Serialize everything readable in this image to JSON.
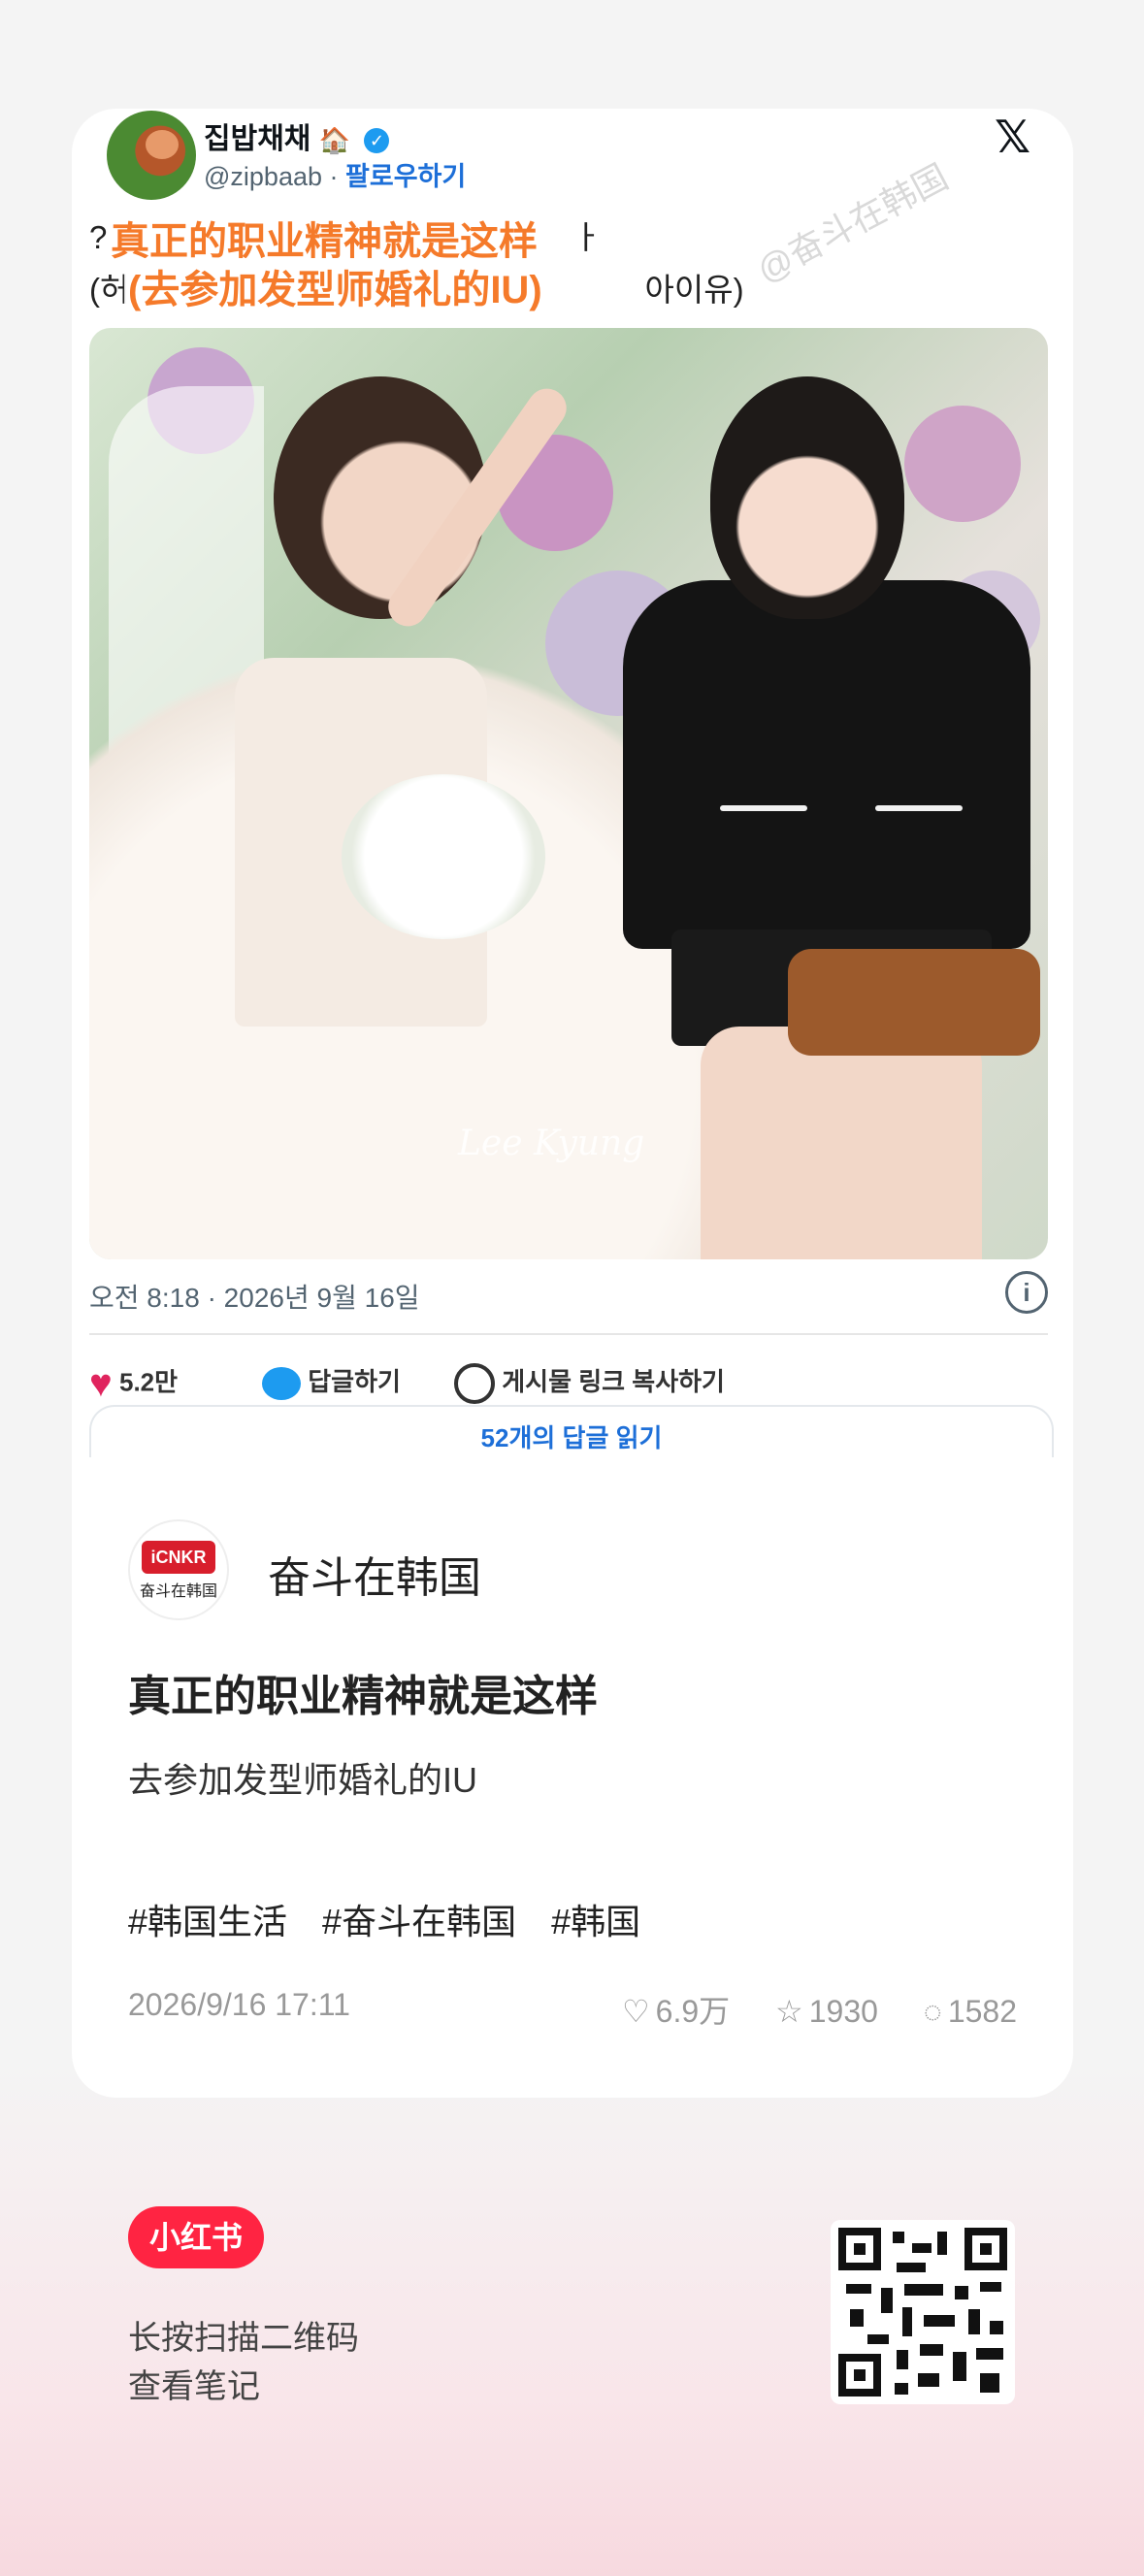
{
  "tweet": {
    "display_name": "집밥채채",
    "handle": "@zipbaab",
    "separator": "·",
    "follow_label": "팔로우하기",
    "text_line1_left": "?",
    "text_line1_right": "ㅏ",
    "text_line2_left": "(허",
    "text_line2_right": "아이유)",
    "overlay_title": "真正的职业精神就是这样",
    "overlay_subtitle": "(去参加发型师婚礼的IU)",
    "watermark": "@奋斗在韩国",
    "photo_signature": "Lee Kyung",
    "timestamp": "오전 8:18 · 2026년 9월 16일",
    "likes": "5.2만",
    "reply_label": "답글하기",
    "copy_link_label": "게시물 링크 복사하기",
    "read_replies_label": "52개의 답글 읽기"
  },
  "note": {
    "author_logo_top": "iCNKR",
    "author_logo_bottom": "奋斗在韩国",
    "author_name": "奋斗在韩国",
    "title": "真正的职业精神就是这样",
    "description": "去参加发型师婚礼的IU",
    "tags": [
      "#韩国生活",
      "#奋斗在韩国",
      "#韩国"
    ],
    "date": "2026/9/16 17:11",
    "likes": "6.9万",
    "collects": "1930",
    "comments": "1582"
  },
  "footer": {
    "brand_badge": "小红书",
    "hint_line1": "长按扫描二维码",
    "hint_line2": "查看笔记"
  },
  "colors": {
    "brand_red": "#ff2442",
    "twitter_blue": "#1d9bf0",
    "overlay_orange": "#f57a2a"
  }
}
